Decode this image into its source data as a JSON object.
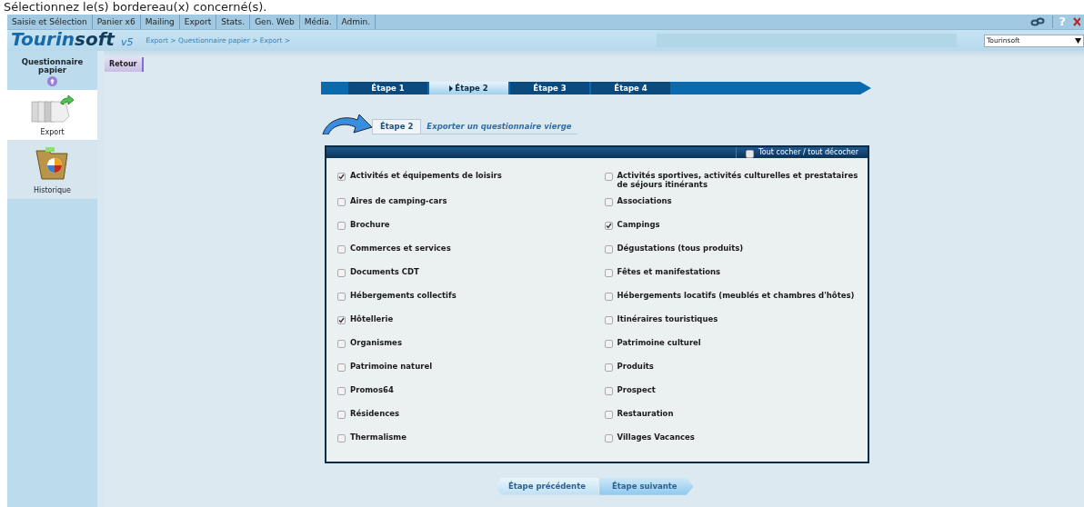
{
  "page_heading": "Sélectionnez le(s) bordereau(x) concerné(s).",
  "menu": [
    {
      "label": "Saisie et Sélection"
    },
    {
      "label": "Panier x6"
    },
    {
      "label": "Mailing"
    },
    {
      "label": "Export"
    },
    {
      "label": "Stats."
    },
    {
      "label": "Gen. Web"
    },
    {
      "label": "Média."
    },
    {
      "label": "Admin."
    }
  ],
  "help_label": "?",
  "logo": {
    "part_a": "Tourin",
    "part_b": "soft",
    "version": "v5"
  },
  "breadcrumb": "Export > Questionnaire papier > Export >",
  "site_select": {
    "value": "Tourinsoft"
  },
  "sidebar": {
    "title": "Questionnaire papier",
    "items": [
      {
        "label": "Export",
        "kind": "export",
        "selected": true
      },
      {
        "label": "Historique",
        "kind": "history",
        "selected": false
      }
    ]
  },
  "back_button": "Retour",
  "steps": [
    {
      "label": "Étape 1",
      "selected": false
    },
    {
      "label": "Étape 2",
      "selected": true
    },
    {
      "label": "Étape 3",
      "selected": false
    },
    {
      "label": "Étape 4",
      "selected": false
    }
  ],
  "step_header": {
    "step": "Étape 2",
    "title": "Exporter un questionnaire vierge"
  },
  "toggle_all": {
    "label": "Tout cocher / tout décocher",
    "checked": false
  },
  "categories": [
    {
      "label": "Activités et équipements de loisirs",
      "checked": true
    },
    {
      "label": "Activités sportives, activités culturelles et prestataires de séjours itinérants",
      "checked": false
    },
    {
      "label": "Aires de camping-cars",
      "checked": false
    },
    {
      "label": "Associations",
      "checked": false
    },
    {
      "label": "Brochure",
      "checked": false
    },
    {
      "label": "Campings",
      "checked": true
    },
    {
      "label": "Commerces et services",
      "checked": false
    },
    {
      "label": "Dégustations (tous produits)",
      "checked": false
    },
    {
      "label": "Documents CDT",
      "checked": false
    },
    {
      "label": "Fêtes et manifestations",
      "checked": false
    },
    {
      "label": "Hébergements collectifs",
      "checked": false
    },
    {
      "label": "Hébergements locatifs (meublés et chambres d'hôtes)",
      "checked": false
    },
    {
      "label": "Hôtellerie",
      "checked": true
    },
    {
      "label": "Itinéraires touristiques",
      "checked": false
    },
    {
      "label": "Organismes",
      "checked": false
    },
    {
      "label": "Patrimoine culturel",
      "checked": false
    },
    {
      "label": "Patrimoine naturel",
      "checked": false
    },
    {
      "label": "Produits",
      "checked": false
    },
    {
      "label": "Promos64",
      "checked": false
    },
    {
      "label": "Prospect",
      "checked": false
    },
    {
      "label": "Résidences",
      "checked": false
    },
    {
      "label": "Restauration",
      "checked": false
    },
    {
      "label": "Thermalisme",
      "checked": false
    },
    {
      "label": "Villages Vacances",
      "checked": false
    }
  ],
  "nav_buttons": [
    {
      "label": "Étape précédente"
    },
    {
      "label": "Étape suivante"
    }
  ]
}
